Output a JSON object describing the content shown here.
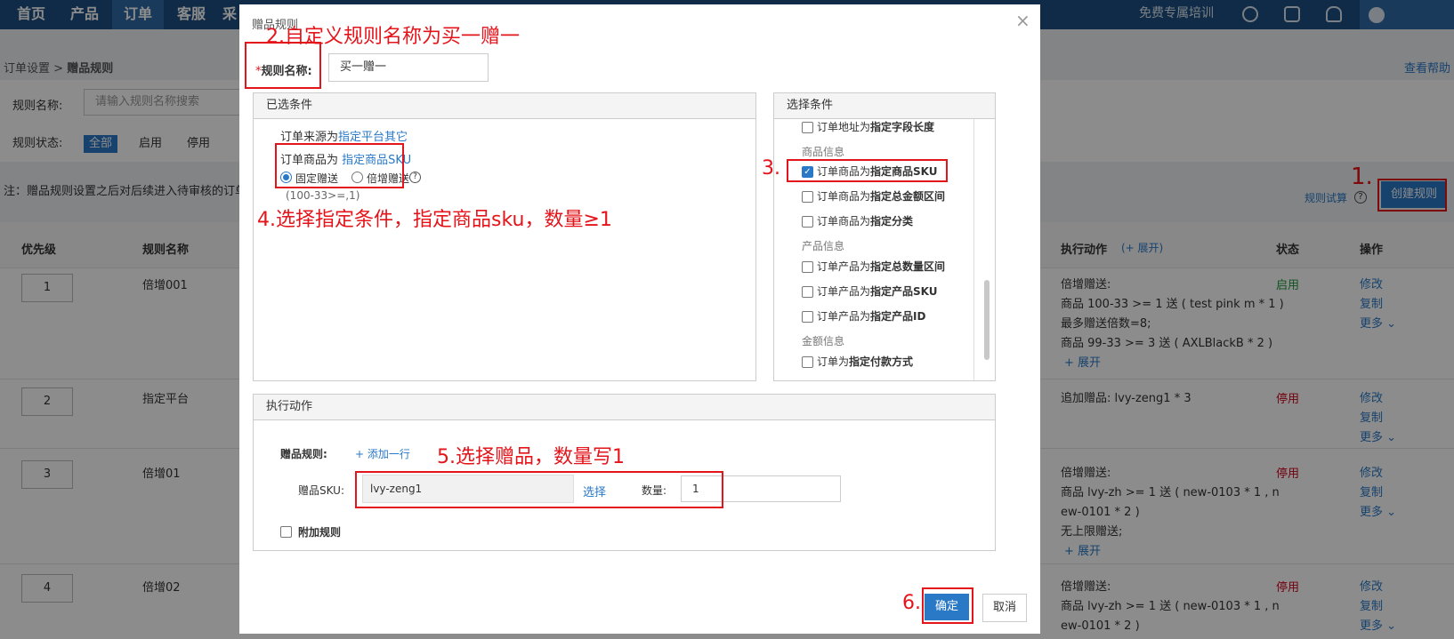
{
  "nav": {
    "items": [
      "首页",
      "产品",
      "订单",
      "客服",
      "采"
    ],
    "training": "免费专属培训"
  },
  "breadcrumb": {
    "parent": "订单设置",
    "sep": ">",
    "current": "赠品规则"
  },
  "help_link": "查看帮助",
  "filter": {
    "name_label": "规则名称:",
    "name_placeholder": "请输入规则名称搜索",
    "status_label": "规则状态:",
    "status_options": [
      "全部",
      "启用",
      "停用"
    ]
  },
  "note": "注：赠品规则设置之后对后续进入待审核的订单",
  "rule_trial": "规则试算",
  "create_button": "创建规则",
  "table": {
    "headers": {
      "priority": "优先级",
      "name": "规则名称",
      "action": "执行动作",
      "expand": "(+ 展开)",
      "status": "状态",
      "ops": "操作"
    },
    "rows": [
      {
        "priority": "1",
        "name": "倍增001",
        "status": "启用",
        "actions": [
          "倍增赠送:",
          "商品 100-33 >= 1 送 ( test pink m * 1 )",
          "最多赠送倍数=8;",
          "商品 99-33 >= 3 送 ( AXLBlackB * 2 )",
          "+ 展开"
        ],
        "ops": [
          "修改",
          "复制",
          "更多"
        ]
      },
      {
        "priority": "2",
        "name": "指定平台",
        "status": "停用",
        "actions": [
          "追加赠品:  lvy-zeng1 * 3"
        ],
        "ops": [
          "修改",
          "复制",
          "更多"
        ]
      },
      {
        "priority": "3",
        "name": "倍增01",
        "status": "停用",
        "actions": [
          "倍增赠送:",
          "商品 lvy-zh >= 1 送 ( new-0103 * 1 , n",
          "ew-0101 * 2 )",
          "无上限赠送;",
          "+ 展开"
        ],
        "ops": [
          "修改",
          "复制",
          "更多"
        ]
      },
      {
        "priority": "4",
        "name": "倍增02",
        "status": "停用",
        "actions": [
          "倍增赠送:",
          "商品 lvy-zh >= 1 送 ( new-0103 * 1 , n",
          "ew-0101 * 2 )"
        ],
        "ops": [
          "修改",
          "复制",
          "更多"
        ]
      }
    ]
  },
  "modal": {
    "title": "赠品规则",
    "close": "×",
    "name_label_star": "*",
    "name_label": "规则名称:",
    "name_value": "买一赠一",
    "selected": {
      "title": "已选条件",
      "line1_prefix": "订单来源为",
      "line1_link": "指定平台其它",
      "line2_prefix": "订单商品为",
      "line2_link": "指定商品SKU",
      "radio_fixed": "固定赠送",
      "radio_multi": "倍增赠送",
      "help": "?",
      "formula": "(100-33>=,1)"
    },
    "choose": {
      "title": "选择条件",
      "items": [
        {
          "type": "cb",
          "prefix": "订单地址为",
          "bold": "指定字段长度",
          "checked": false
        },
        {
          "type": "section",
          "label": "商品信息"
        },
        {
          "type": "cb",
          "prefix": "订单商品为",
          "bold": "指定商品SKU",
          "checked": true
        },
        {
          "type": "cb",
          "prefix": "订单商品为",
          "bold": "指定总金额区间",
          "checked": false
        },
        {
          "type": "cb",
          "prefix": "订单商品为",
          "bold": "指定分类",
          "checked": false
        },
        {
          "type": "section",
          "label": "产品信息"
        },
        {
          "type": "cb",
          "prefix": "订单产品为",
          "bold": "指定总数量区间",
          "checked": false
        },
        {
          "type": "cb",
          "prefix": "订单产品为",
          "bold": "指定产品SKU",
          "checked": false
        },
        {
          "type": "cb",
          "prefix": "订单产品为",
          "bold": "指定产品ID",
          "checked": false
        },
        {
          "type": "section",
          "label": "金额信息"
        },
        {
          "type": "cb",
          "prefix": "订单为",
          "bold": "指定付款方式",
          "checked": false
        }
      ]
    },
    "action": {
      "title": "执行动作",
      "gift_rule_label": "赠品规则:",
      "add_row": "+ 添加一行",
      "sku_label": "赠品SKU:",
      "sku_value": "lvy-zeng1",
      "select_btn": "选择",
      "qty_label": "数量:",
      "qty_value": "1",
      "extra_rule": "附加规则"
    },
    "confirm": "确定",
    "cancel": "取消"
  },
  "annotations": {
    "a1": "1.",
    "a2": "2.自定义规则名称为买一赠一",
    "a3": "3.",
    "a4": "4.选择指定条件，指定商品sku，数量≥1",
    "a5": "5.选择赠品，数量写1",
    "a6": "6."
  },
  "colors": {
    "nav": "#1d4f82",
    "primary": "#2a79c7",
    "annotation": "#e4141b",
    "enabled": "#1c9a3c",
    "disabled": "#d0021b"
  }
}
